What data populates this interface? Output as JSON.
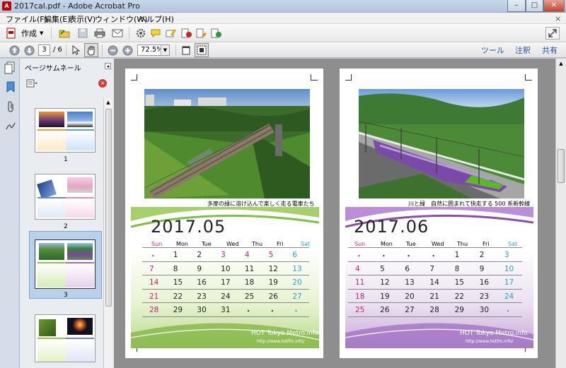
{
  "window": {
    "title": "2017cal.pdf - Adobe Acrobat Pro"
  },
  "menu": [
    "ファイル(F)",
    "編集(E)",
    "表示(V)",
    "ウィンドウ(W)",
    "ヘルプ(H)"
  ],
  "toolbar": {
    "create_label": "作成",
    "page_current": "3",
    "page_total": "/ 6",
    "zoom": "72.5%"
  },
  "right_buttons": [
    "ツール",
    "注釈",
    "共有"
  ],
  "sidebar": {
    "title": "ページサムネール",
    "pages": [
      "1",
      "2",
      "3"
    ]
  },
  "calendars": [
    {
      "month": "2017.05",
      "caption": "多摩の緑に溶け込んで楽しく走る電車たち",
      "footer": "HOT Tokyo Metro.info",
      "url": "http://www.hotfm.info/",
      "weeks": [
        [
          "・",
          "1",
          "2",
          "3",
          "4",
          "5",
          "6"
        ],
        [
          "7",
          "8",
          "9",
          "10",
          "11",
          "12",
          "13"
        ],
        [
          "14",
          "15",
          "16",
          "17",
          "18",
          "19",
          "20"
        ],
        [
          "21",
          "22",
          "23",
          "24",
          "25",
          "26",
          "27"
        ],
        [
          "28",
          "29",
          "30",
          "31",
          "・",
          "・",
          "・"
        ]
      ],
      "holidays": [
        "3",
        "4",
        "5"
      ]
    },
    {
      "month": "2017.06",
      "caption": "川と緑　自然に囲まれて快走する 500 系新幹線",
      "footer": "HOT Tokyo Metro.info",
      "url": "http://www.hotfm.info/",
      "weeks": [
        [
          "・",
          "・",
          "・",
          "・",
          "1",
          "2",
          "3"
        ],
        [
          "4",
          "5",
          "6",
          "7",
          "8",
          "9",
          "10"
        ],
        [
          "11",
          "12",
          "13",
          "14",
          "15",
          "16",
          "17"
        ],
        [
          "18",
          "19",
          "20",
          "21",
          "22",
          "23",
          "24"
        ],
        [
          "25",
          "26",
          "27",
          "28",
          "29",
          "30",
          "・"
        ]
      ],
      "holidays": []
    }
  ],
  "weekdays": [
    "Sun",
    "Mon",
    "Tue",
    "Wed",
    "Thu",
    "Fri",
    "Sat"
  ],
  "colors": {
    "sun": "#d6207a",
    "sat": "#2a9fd6",
    "accent_green": "#7cc242",
    "accent_purple": "#8b4fa8"
  }
}
